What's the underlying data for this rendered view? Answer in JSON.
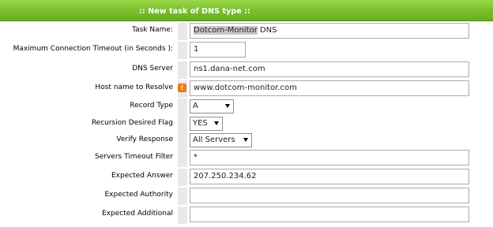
{
  "header": {
    "title": ":: New task of DNS type ::"
  },
  "form": {
    "task_name": {
      "label": "Task Name:",
      "value_highlight": "Dotcom-Monitor",
      "value_rest": " DNS"
    },
    "max_timeout": {
      "label": "Maximum Connection Timeout (in Seconds ):",
      "value": "1"
    },
    "dns_server": {
      "label": "DNS Server",
      "value": "ns1.dana-net.com"
    },
    "host_name": {
      "label": "Host name to Resolve",
      "value": "www.dotcom-monitor.com",
      "warning_icon": "!"
    },
    "record_type": {
      "label": "Record Type",
      "value": "A"
    },
    "recursion": {
      "label": "Recursion Desired Flag",
      "value": "YES"
    },
    "verify_response": {
      "label": "Verify Response",
      "value": "All Servers"
    },
    "servers_timeout_filter": {
      "label": "Servers Timeout Filter",
      "value": "*"
    },
    "expected_answer": {
      "label": "Expected Answer",
      "value": "207.250.234.62"
    },
    "expected_authority": {
      "label": "Expected Authority",
      "value": ""
    },
    "expected_additional": {
      "label": "Expected Additional",
      "value": ""
    }
  },
  "icons": {
    "warning": "warning-icon",
    "dropdown": "chevron-down-icon"
  },
  "colors": {
    "header_green": "#7cc22f",
    "warning_orange": "#ee7a13"
  }
}
